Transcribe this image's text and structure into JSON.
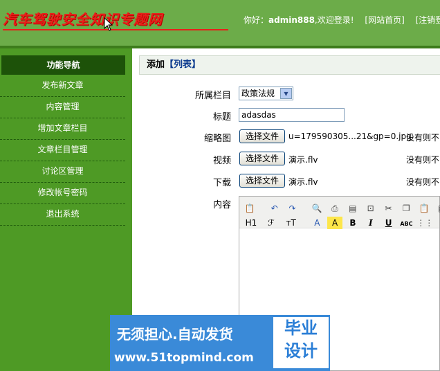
{
  "header": {
    "site_title": "汽车驾驶安全知识专题网",
    "greeting_prefix": "你好：",
    "username": "admin888",
    "greeting_suffix": ",欢迎登录!",
    "home_link": "[网站首页]",
    "logout_link": "[注销登录]"
  },
  "sidebar": {
    "heading": "功能导航",
    "items": [
      {
        "label": "发布新文章"
      },
      {
        "label": "内容管理"
      },
      {
        "label": "增加文章栏目"
      },
      {
        "label": "文章栏目管理"
      },
      {
        "label": "讨论区管理"
      },
      {
        "label": "修改帐号密码"
      },
      {
        "label": "退出系统"
      }
    ]
  },
  "panel": {
    "title_prefix": "添加",
    "list_link": "【列表】"
  },
  "form": {
    "category_label": "所属栏目",
    "category_value": "政策法规",
    "title_label": "标题",
    "title_value": "adasdas",
    "thumb_label": "缩略图",
    "video_label": "视频",
    "download_label": "下载",
    "content_label": "内容",
    "file_button": "选择文件",
    "thumb_file": "u=179590305...21&gp=0.jpg",
    "video_file": "演示.flv",
    "download_file": "演示.flv",
    "hint_text": "没有则不"
  },
  "editor_toolbar": {
    "row1": [
      "paste-text-icon",
      "undo-icon",
      "redo-icon",
      "preview-icon",
      "print-icon",
      "template-icon",
      "code-icon",
      "cut-icon",
      "copy-icon",
      "paste-icon",
      "paste-word-icon"
    ],
    "heading_btn": "H1",
    "font_btn": "ℱ",
    "size_btn": "тT",
    "font_color_btn": "A",
    "bg_color_btn": "A",
    "bold_btn": "B",
    "italic_btn": "I",
    "underline_btn": "U",
    "strike_btn": "ABC",
    "highlight_color": "#fde64a"
  },
  "ad": {
    "line1": "无须担心.自动发货",
    "line2": "www.51topmind.com",
    "badge_line1": "毕业",
    "badge_line2": "设计"
  },
  "colors": {
    "header_bg": "#6cac49",
    "sidebar_bg": "#4e9a25",
    "sidebar_head_bg": "#1d5209",
    "title_red": "#e8201a",
    "ad_blue": "#3a8ad8"
  }
}
